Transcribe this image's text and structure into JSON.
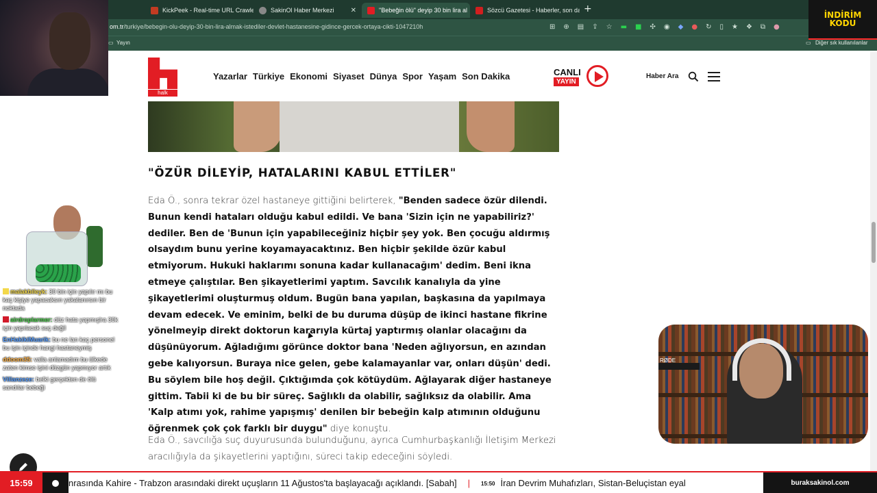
{
  "browser": {
    "tabs": [
      {
        "label": "KickPeek - Real-time URL Crawler",
        "color": "#c23b22"
      },
      {
        "label": "SakinOl Haber Merkezi",
        "color": "#888888"
      },
      {
        "label": "\"Bebeğin ölü\" deyip 30 bin lira al",
        "color": "#e21d24"
      },
      {
        "label": "Sözcü Gazetesi - Haberler, son da",
        "color": "#d01f1f"
      }
    ],
    "url_prefix": "om.tr",
    "url_path": "/turkiye/bebegin-olu-deyip-30-bin-lira-almak-istediler-devlet-hastanesine-gidince-gercek-ortaya-cikti-1047210h",
    "bookmarks": {
      "left": "Yayın",
      "right": "Diğer sık kullanılanlar"
    }
  },
  "promo": {
    "line1": "İNDİRİM",
    "line2": "KODU"
  },
  "site": {
    "logo_text": "halk",
    "nav": [
      "Yazarlar",
      "Türkiye",
      "Ekonomi",
      "Siyaset",
      "Dünya",
      "Spor",
      "Yaşam",
      "Son Dakika"
    ],
    "live": {
      "line1": "CANLI",
      "line2": "YAYIN"
    },
    "search_label": "Haber Ara"
  },
  "article": {
    "heading": "\"ÖZÜR DİLEYİP, HATALARINI KABUL ETTİLER\"",
    "para1_lead": "Eda Ö., sonra tekrar özel hastaneye gittiğini belirterek, ",
    "para1_quote": "\"Benden sadece özür dilendi. Bunun kendi hataları olduğu kabul edildi. Ve bana 'Sizin için ne yapabiliriz?' dediler. Ben de 'Bunun için yapabileceğiniz hiçbir şey yok. Ben çocuğu aldırmış olsaydım bunu yerine koyamayacaktınız. Ben hiçbir şekilde özür kabul etmiyorum. Hukuki haklarımı sonuna kadar kullanacağım' dedim. Beni ikna etmeye çalıştılar. Ben şikayetlerimi yaptım. Savcılık kanalıyla da yine şikayetlerimi oluşturmuş oldum. Bugün bana yapılan, başkasına da yapılmaya devam edecek. Ve eminim, belki de bu duruma düşüp de ikinci hastane fikrine yönelmeyip direkt doktorun kararıyla kürtaj yaptırmış olanlar olacağını da düşünüyorum. Ağladığımı görünce doktor bana 'Neden ağlıyorsun, en azından gebe kalıyorsun. Buraya nice gelen, gebe kalamayanlar var, onları düşün' dedi. Bu söylem bile hoş değil. Çıktığımda çok kötüydüm. Ağlayarak diğer hastaneye gittim. Tabii ki de bu bir süreç. Sağlıklı da olabilir, sağlıksız da olabilir. Ama 'Kalp atımı yok, rahime yapışmış' denilen bir bebeğin kalp atımının olduğunu öğrenmek çok çok farklı bir duygu\"",
    "para1_tail": " diye konuştu.",
    "para2": "Eda Ö., savcılığa suç duyurusunda bulunduğunu, ayrıca Cumhurbaşkanlığı İletişim Merkezi aracılığıyla da şikayetlerini yaptığını, süreci takip edeceğini söyledi."
  },
  "chat": [
    {
      "user": "malakbileyk:",
      "text": "30 bin için yapılır mı bu kaç kişiye yapacaksın yakalanırsın bir noktada",
      "color": "#f3d84a",
      "badge": "#f3d84a"
    },
    {
      "user": "airdroplarmer:",
      "text": "düz hata yapmışlra 30k için yapılacak suç değil",
      "color": "#4fd14f",
      "badge": "#d11a2a"
    },
    {
      "user": "EnHakikiMuarik:",
      "text": "bu ne lan kaç personel bu işin içinde hangi hastaneymiş",
      "color": "#5aa0ff",
      "badge": ""
    },
    {
      "user": "ddoom35:",
      "text": "valla anlamadım bu ülkede zaten kimse işini düzgün yapmıyor artık",
      "color": "#ffb347",
      "badge": ""
    },
    {
      "user": "Villanzeze:",
      "text": "belki gerçekten de ölü sandılar bebeği",
      "color": "#5aa0ff",
      "badge": ""
    }
  ],
  "webcam_tag": "RØDE",
  "ticker": {
    "time": "15:59",
    "item1": "nrasında Kahire - Trabzon arasındaki direkt uçuşların 11 Ağustos'ta başlayacağı açıklandı. [Sabah]",
    "separator": "|",
    "item2_time": "15:50",
    "item2": "İran Devrim Muhafızları, Sistan-Beluçistan eyal",
    "site": "buraksakinol.com"
  }
}
